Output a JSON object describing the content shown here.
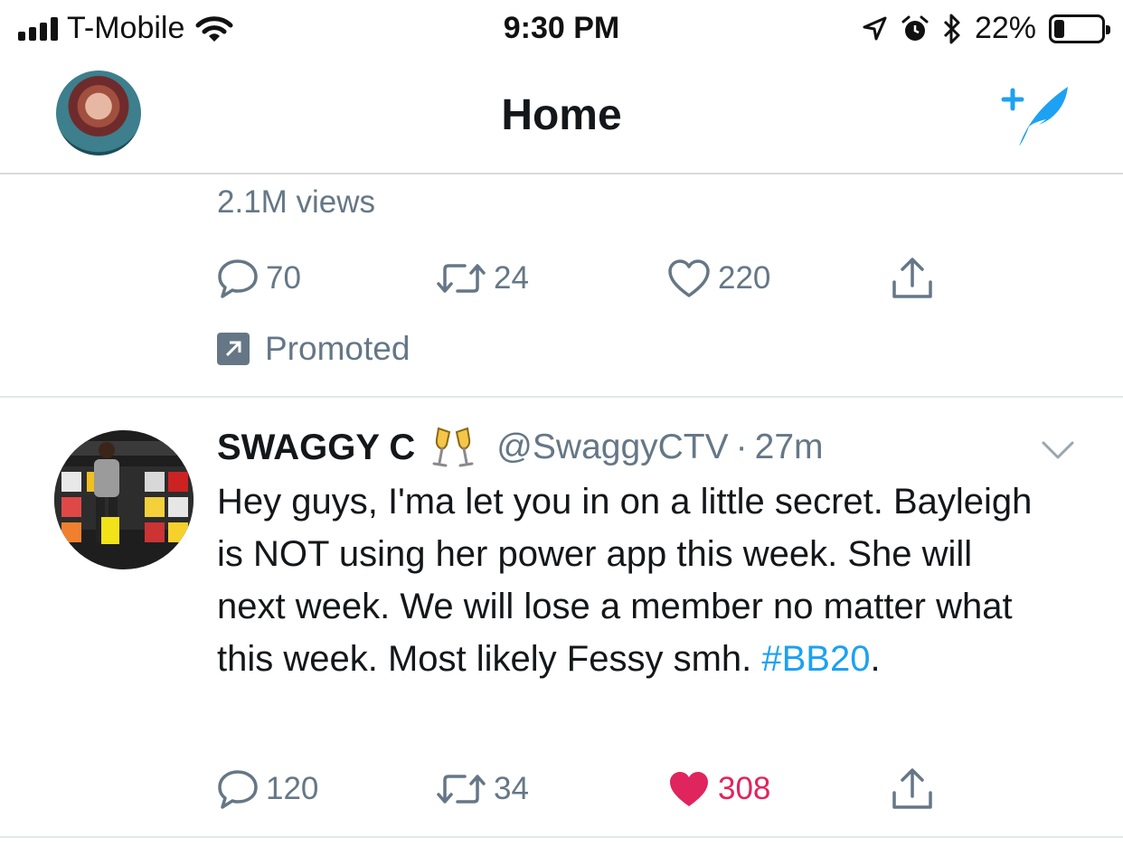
{
  "status_bar": {
    "carrier": "T-Mobile",
    "time": "9:30 PM",
    "battery_percent": "22%",
    "battery_level": 0.22,
    "icons": [
      "signal-icon",
      "wifi-icon",
      "location-icon",
      "alarm-icon",
      "bluetooth-icon",
      "battery-icon"
    ]
  },
  "nav": {
    "title": "Home",
    "compose_icon": "compose-tweet-icon",
    "accent_color": "#1da1f2"
  },
  "promoted_tweet": {
    "views": "2.1M views",
    "replies": "70",
    "retweets": "24",
    "likes": "220",
    "promoted_label": "Promoted"
  },
  "tweet": {
    "display_name": "SWAGGY C",
    "name_emoji": "champagne-glasses-icon",
    "handle": "@SwaggyCTV",
    "separator": "·",
    "time_ago": "27m",
    "text": "Hey guys, I'ma let you in on a little secret. Bayleigh is NOT using her power app this week. She will next week. We will lose a member no matter what this week. Most likely Fessy smh.",
    "hashtag": "#BB20",
    "text_end": ".",
    "replies": "120",
    "retweets": "34",
    "likes": "308",
    "liked": true,
    "like_color": "#e0245e"
  }
}
